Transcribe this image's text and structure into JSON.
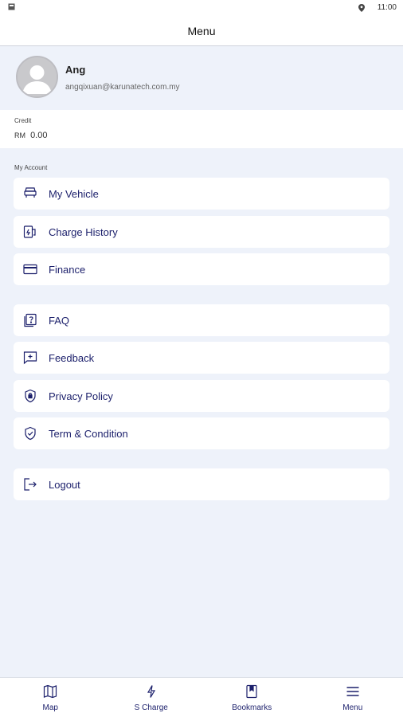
{
  "status_bar": {
    "time": "11:00"
  },
  "header": {
    "title": "Menu"
  },
  "profile": {
    "name": "Ang",
    "email": "angqixuan@karunatech.com.my"
  },
  "credit": {
    "label": "Credit",
    "currency": "RM",
    "value": "0.00"
  },
  "account_section": {
    "label": "My Account",
    "items": [
      {
        "label": "My Vehicle",
        "icon": "vehicle-icon"
      },
      {
        "label": "Charge History",
        "icon": "charge-history-icon"
      },
      {
        "label": "Finance",
        "icon": "card-icon"
      }
    ]
  },
  "support_section": {
    "items": [
      {
        "label": "FAQ",
        "icon": "question-icon"
      },
      {
        "label": "Feedback",
        "icon": "feedback-icon"
      },
      {
        "label": "Privacy Policy",
        "icon": "privacy-icon"
      },
      {
        "label": "Term & Condition",
        "icon": "shield-check-icon"
      }
    ]
  },
  "logout": {
    "label": "Logout",
    "icon": "logout-icon"
  },
  "bottom_nav": [
    {
      "label": "Map",
      "icon": "map-icon"
    },
    {
      "label": "S Charge",
      "icon": "bolt-icon"
    },
    {
      "label": "Bookmarks",
      "icon": "bookmark-icon"
    },
    {
      "label": "Menu",
      "icon": "menu-icon"
    }
  ],
  "colors": {
    "accent": "#1b1f6b",
    "background": "#eef2fa"
  }
}
